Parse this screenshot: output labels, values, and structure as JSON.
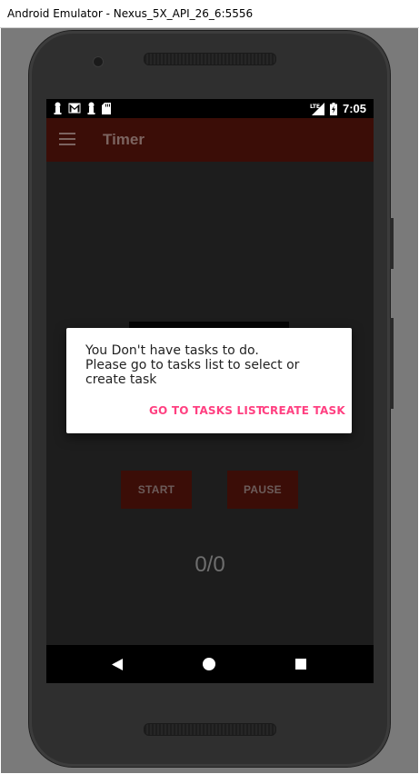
{
  "window": {
    "title": "Android Emulator - Nexus_5X_API_26_6:5556"
  },
  "statusbar": {
    "left_icons": [
      "pawn-icon",
      "gmail-icon",
      "pawn-icon",
      "sd-card-icon"
    ],
    "network": "LTE",
    "time": "7:05"
  },
  "appbar": {
    "title": "Timer"
  },
  "main": {
    "start_label": "START",
    "pause_label": "PAUSE",
    "counter": "0/0"
  },
  "dialog": {
    "message": "You Don't have tasks to do.\nPlease go to tasks list to select or\ncreate task",
    "go_to_tasks_label": "GO TO TASKS LIST",
    "create_task_label": "CREATE TASK"
  },
  "colors": {
    "appbar": "#3b0d07",
    "accent": "#ff4081",
    "background": "#1d1d1d"
  }
}
